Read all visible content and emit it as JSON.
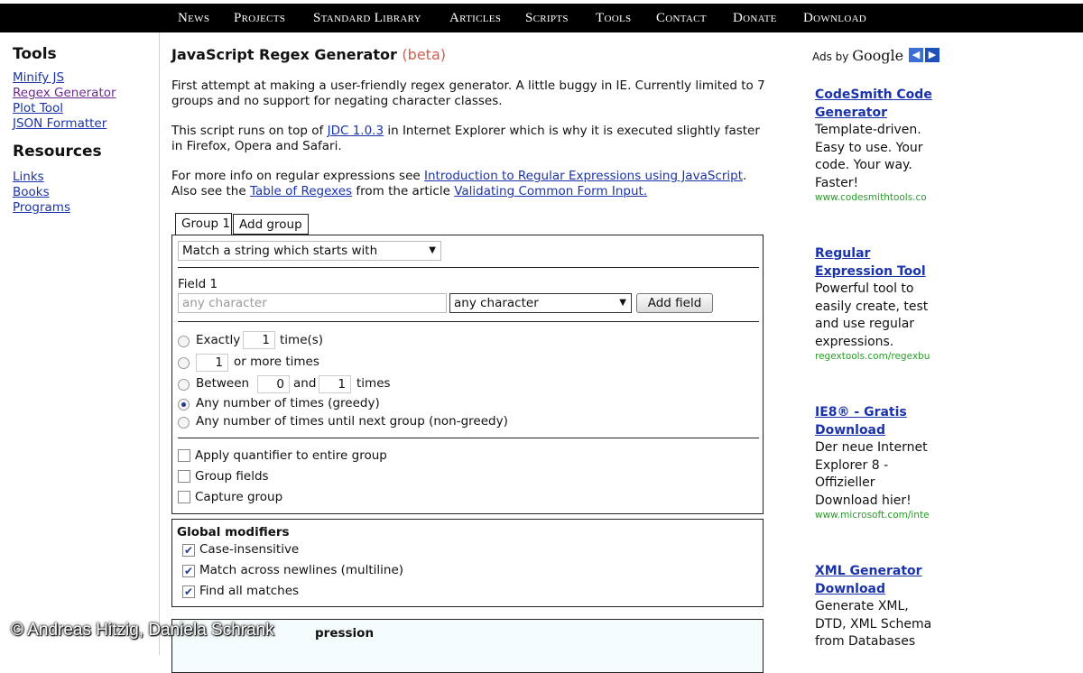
{
  "nav": [
    "News",
    "Projects",
    "Standard Library",
    "Articles",
    "Scripts",
    "Tools",
    "Contact",
    "Donate",
    "Download"
  ],
  "sidebar": {
    "tools_heading": "Tools",
    "tools_links": [
      "Minify JS",
      "Regex Generator",
      "Plot Tool",
      "JSON Formatter"
    ],
    "resources_heading": "Resources",
    "resources_links": [
      "Links",
      "Books",
      "Programs"
    ]
  },
  "main": {
    "title": "JavaScript Regex Generator",
    "beta": "(beta)",
    "p1": "First attempt at making a user-friendly regex generator. A little buggy in IE. Currently limited to 7 groups and no support for negating character classes.",
    "p2_a": "This script runs on top of ",
    "p2_link": "JDC 1.0.3",
    "p2_b": " in Internet Explorer which is why it is executed slightly faster in Firefox, Opera and Safari.",
    "p3_a": "For more info on regular expressions see ",
    "p3_link1": "Introduction to Regular Expressions using JavaScript",
    "p3_b": ". Also see the ",
    "p3_link2": "Table of Regexes",
    "p3_c": " from the article ",
    "p3_link3": "Validating Common Form Input."
  },
  "tabs": [
    "Group 1",
    "Add group"
  ],
  "group": {
    "match_select": "Match a string which starts with",
    "field_label": "Field 1",
    "field_placeholder": "any character",
    "field_select": "any character",
    "add_field": "Add field",
    "exactly": "Exactly",
    "exactly_value": "1",
    "times": "time(s)",
    "or_more_value": "1",
    "or_more": "or more times",
    "between": "Between",
    "between_min": "0",
    "and": "and",
    "between_max": "1",
    "times2": "times",
    "greedy": "Any number of times (greedy)",
    "nongreedy": "Any number of times until next group (non-greedy)",
    "apply_quantifier": "Apply quantifier to entire group",
    "group_fields": "Group fields",
    "capture_group": "Capture group"
  },
  "modifiers": {
    "heading": "Global modifiers",
    "case_insensitive": "Case-insensitive",
    "multiline": "Match across newlines (multiline)",
    "find_all": "Find all matches"
  },
  "result_heading_partial": "pression",
  "ads": {
    "label": "Ads by",
    "brand": "Google",
    "items": [
      {
        "title": "CodeSmith Code Generator",
        "text": "Template-driven. Easy to use. Your code. Your way. Faster!",
        "url": "www.codesmithtools.co"
      },
      {
        "title": "Regular Expression Tool",
        "text": "Powerful tool to easily create, test and use regular expressions.",
        "url": "regextools.com/regexbu"
      },
      {
        "title": "IE8® - Gratis Download",
        "text": "Der neue Internet Explorer 8 - Offizieller Download hier!",
        "url": "www.microsoft.com/inte"
      },
      {
        "title": "XML Generator Download",
        "text": "Generate XML, DTD, XML Schema from Databases",
        "url": ""
      }
    ]
  },
  "watermark": "© Andreas Hitzig, Daniela Schrank"
}
